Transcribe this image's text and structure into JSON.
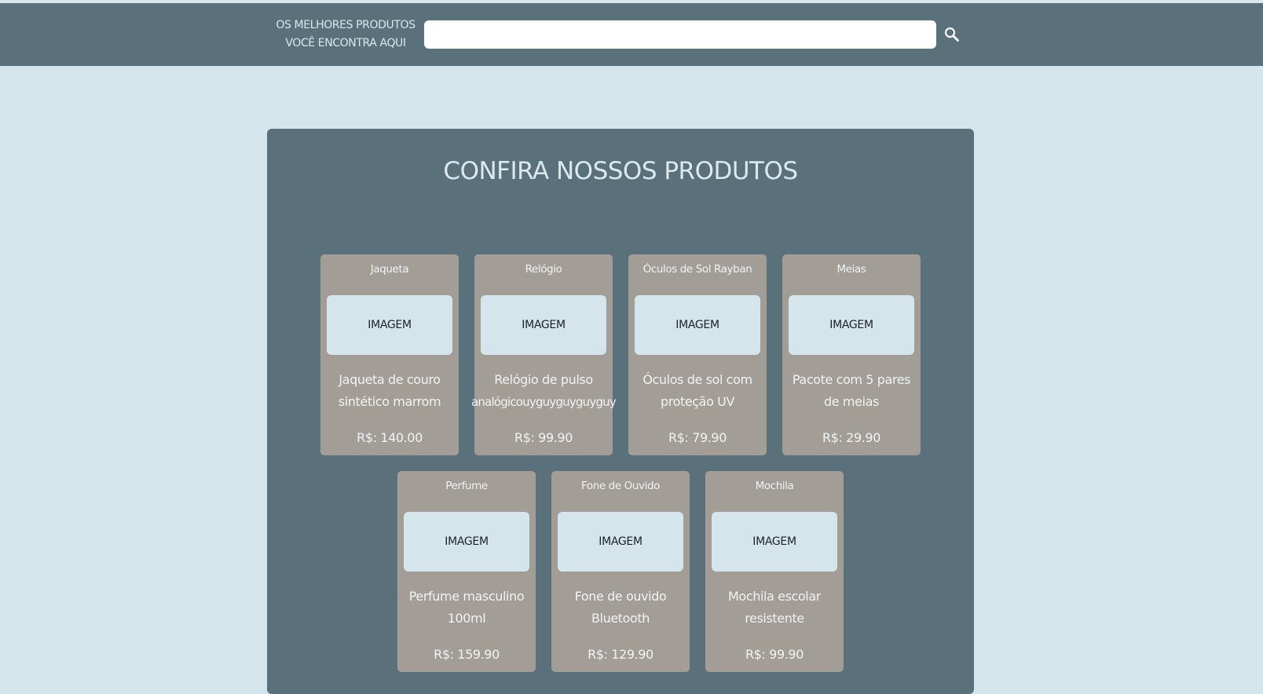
{
  "header": {
    "tagline_line1": "OS MELHORES PRODUTOS",
    "tagline_line2": "VOCÊ ENCONTRA AQUI",
    "search_value": "",
    "search_icon": "search-icon"
  },
  "main": {
    "title": "CONFIRA NOSSOS PRODUTOS",
    "products": [
      {
        "name": "Jaqueta",
        "image_label": "IMAGEM",
        "desc_line1": "Jaqueta de couro",
        "desc_line2": "sintético marrom",
        "price": "R$: 140.00"
      },
      {
        "name": "Relógio",
        "image_label": "IMAGEM",
        "desc_line1": "Relógio de pulso",
        "desc_line2": "analógicouyguyguyguyguy",
        "price": "R$: 99.90"
      },
      {
        "name": "Óculos de Sol Rayban",
        "image_label": "IMAGEM",
        "desc_line1": "Óculos de sol com",
        "desc_line2": "proteção UV",
        "price": "R$: 79.90"
      },
      {
        "name": "Meias",
        "image_label": "IMAGEM",
        "desc_line1": "Pacote com 5 pares",
        "desc_line2": "de meias",
        "price": "R$: 29.90"
      },
      {
        "name": "Perfume",
        "image_label": "IMAGEM",
        "desc_line1": "Perfume masculino",
        "desc_line2": "100ml",
        "price": "R$: 159.90"
      },
      {
        "name": "Fone de Ouvido",
        "image_label": "IMAGEM",
        "desc_line1": "Fone de ouvido",
        "desc_line2": "Bluetooth",
        "price": "R$: 129.90"
      },
      {
        "name": "Mochila",
        "image_label": "IMAGEM",
        "desc_line1": "Mochila escolar",
        "desc_line2": "resistente",
        "price": "R$: 99.90"
      }
    ]
  },
  "colors": {
    "page_background": "#d4e5ec",
    "header_background": "#5a707a",
    "panel_background": "#5a707a",
    "card_background": "#a39d97",
    "text_light": "#dbe8ee"
  }
}
